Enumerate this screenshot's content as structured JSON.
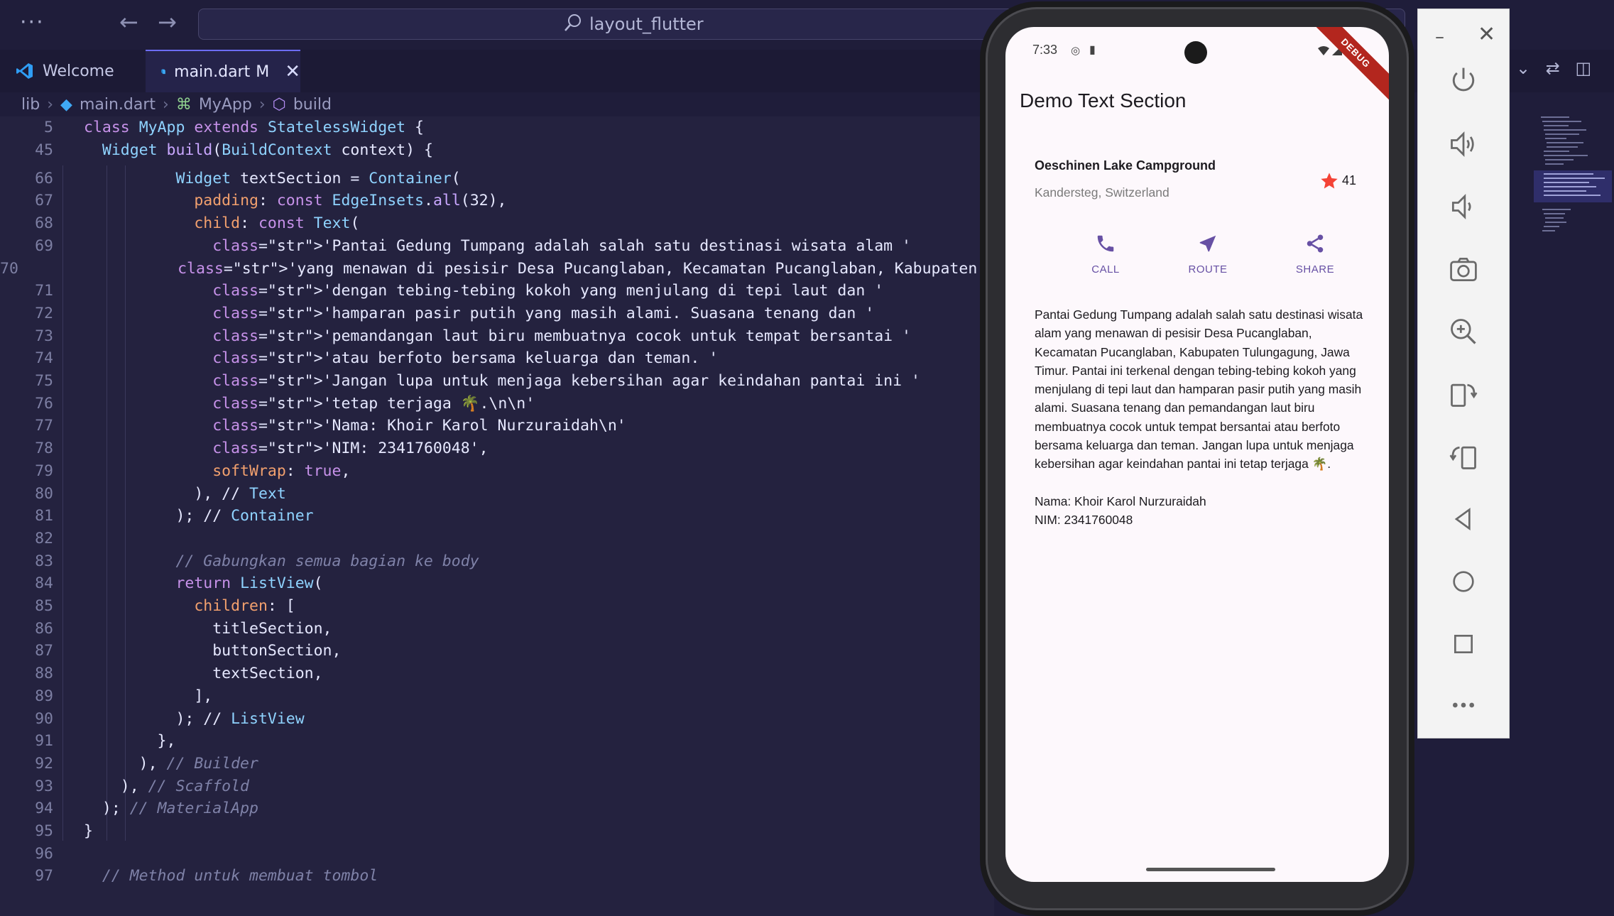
{
  "window": {
    "search_text": "layout_flutter"
  },
  "tabs": [
    {
      "label": "Welcome"
    },
    {
      "label": "main.dart",
      "modified": "M"
    }
  ],
  "breadcrumb": [
    "lib",
    "main.dart",
    "MyApp",
    "build"
  ],
  "editor": {
    "sticky_lines": [
      {
        "num": "5",
        "text": "class MyApp extends StatelessWidget {"
      },
      {
        "num": "45",
        "text": "  Widget build(BuildContext context) {"
      }
    ],
    "lines": [
      {
        "num": "66",
        "text": "          Widget textSection = Container("
      },
      {
        "num": "67",
        "text": "            padding: const EdgeInsets.all(32),"
      },
      {
        "num": "68",
        "text": "            child: const Text("
      },
      {
        "num": "69",
        "text": "              'Pantai Gedung Tumpang adalah salah satu destinasi wisata alam '"
      },
      {
        "num": "70",
        "text": "              'yang menawan di pesisir Desa Pucanglaban, Kecamatan Pucanglaban, Kabupaten Tulunga"
      },
      {
        "num": "71",
        "text": "              'dengan tebing-tebing kokoh yang menjulang di tepi laut dan '"
      },
      {
        "num": "72",
        "text": "              'hamparan pasir putih yang masih alami. Suasana tenang dan '"
      },
      {
        "num": "73",
        "text": "              'pemandangan laut biru membuatnya cocok untuk tempat bersantai '"
      },
      {
        "num": "74",
        "text": "              'atau berfoto bersama keluarga dan teman. '"
      },
      {
        "num": "75",
        "text": "              'Jangan lupa untuk menjaga kebersihan agar keindahan pantai ini '"
      },
      {
        "num": "76",
        "text": "              'tetap terjaga 🌴.\\n\\n'"
      },
      {
        "num": "77",
        "text": "              'Nama: Khoir Karol Nurzuraidah\\n'"
      },
      {
        "num": "78",
        "text": "              'NIM: 2341760048',"
      },
      {
        "num": "79",
        "text": "              softWrap: true,"
      },
      {
        "num": "80",
        "text": "            ), // Text"
      },
      {
        "num": "81",
        "text": "          ); // Container"
      },
      {
        "num": "82",
        "text": ""
      },
      {
        "num": "83",
        "text": "          // Gabungkan semua bagian ke body"
      },
      {
        "num": "84",
        "text": "          return ListView("
      },
      {
        "num": "85",
        "text": "            children: ["
      },
      {
        "num": "86",
        "text": "              titleSection,"
      },
      {
        "num": "87",
        "text": "              buttonSection,"
      },
      {
        "num": "88",
        "text": "              textSection,"
      },
      {
        "num": "89",
        "text": "            ],"
      },
      {
        "num": "90",
        "text": "          ); // ListView"
      },
      {
        "num": "91",
        "text": "        },"
      },
      {
        "num": "92",
        "text": "      ), // Builder"
      },
      {
        "num": "93",
        "text": "    ), // Scaffold"
      },
      {
        "num": "94",
        "text": "  ); // MaterialApp"
      },
      {
        "num": "95",
        "text": "}"
      },
      {
        "num": "96",
        "text": ""
      },
      {
        "num": "97",
        "text": "  // Method untuk membuat tombol"
      }
    ]
  },
  "phone": {
    "time": "7:33",
    "debug_banner": "DEBUG",
    "app_title": "Demo Text Section",
    "place_name": "Oeschinen Lake Campground",
    "place_location": "Kandersteg, Switzerland",
    "star_count": "41",
    "actions": [
      {
        "label": "CALL",
        "icon": "phone-icon"
      },
      {
        "label": "ROUTE",
        "icon": "navigation-icon"
      },
      {
        "label": "SHARE",
        "icon": "share-icon"
      }
    ],
    "body_text": "Pantai Gedung Tumpang adalah salah satu destinasi wisata alam yang menawan di pesisir Desa Pucanglaban, Kecamatan Pucanglaban, Kabupaten Tulungagung, Jawa Timur. Pantai ini terkenal dengan tebing-tebing kokoh yang menjulang di tepi laut dan hamparan pasir putih yang masih alami. Suasana tenang dan pemandangan laut biru membuatnya cocok untuk tempat bersantai atau berfoto bersama keluarga dan teman. Jangan lupa untuk menjaga kebersihan agar keindahan pantai ini tetap terjaga 🌴.\n\nNama: Khoir Karol Nurzuraidah\nNIM: 2341760048",
    "accent_color": "#6750a4",
    "star_color": "#f44336"
  },
  "emulator_toolbar": {
    "buttons": [
      "power-icon",
      "volume-up-icon",
      "volume-down-icon",
      "camera-icon",
      "zoom-in-icon",
      "rotate-left-icon",
      "rotate-right-icon",
      "back-icon",
      "home-icon",
      "overview-icon",
      "more-icon"
    ]
  }
}
